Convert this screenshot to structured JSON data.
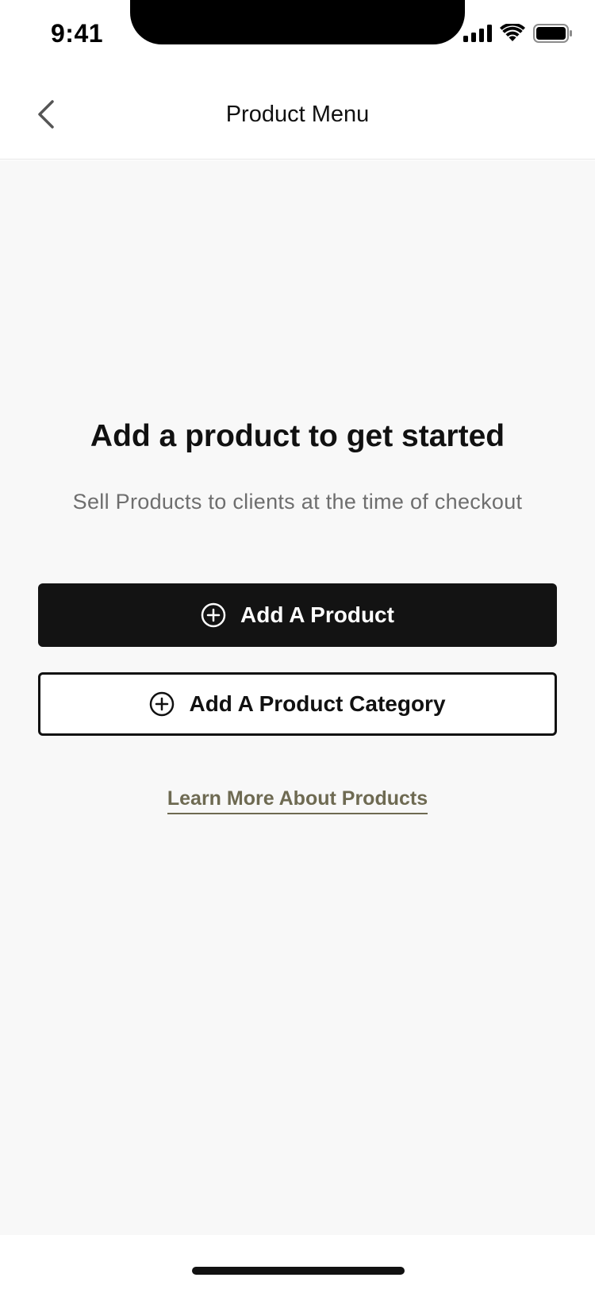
{
  "status_bar": {
    "time": "9:41",
    "icons": [
      "signal-icon",
      "wifi-icon",
      "battery-icon"
    ]
  },
  "nav": {
    "title": "Product Menu",
    "back_icon": "chevron-left-icon"
  },
  "empty_state": {
    "title": "Add a product to get started",
    "subtitle": "Sell Products to clients at the time of checkout"
  },
  "actions": {
    "add_product_label": "Add A Product",
    "add_category_label": "Add A Product Category",
    "add_icon": "plus-circle-icon",
    "learn_more_label": "Learn More About Products"
  },
  "colors": {
    "primary_button": "#131313",
    "link": "#6e6a52",
    "background": "#f8f8f8",
    "subtitle": "#6e6e6e"
  }
}
